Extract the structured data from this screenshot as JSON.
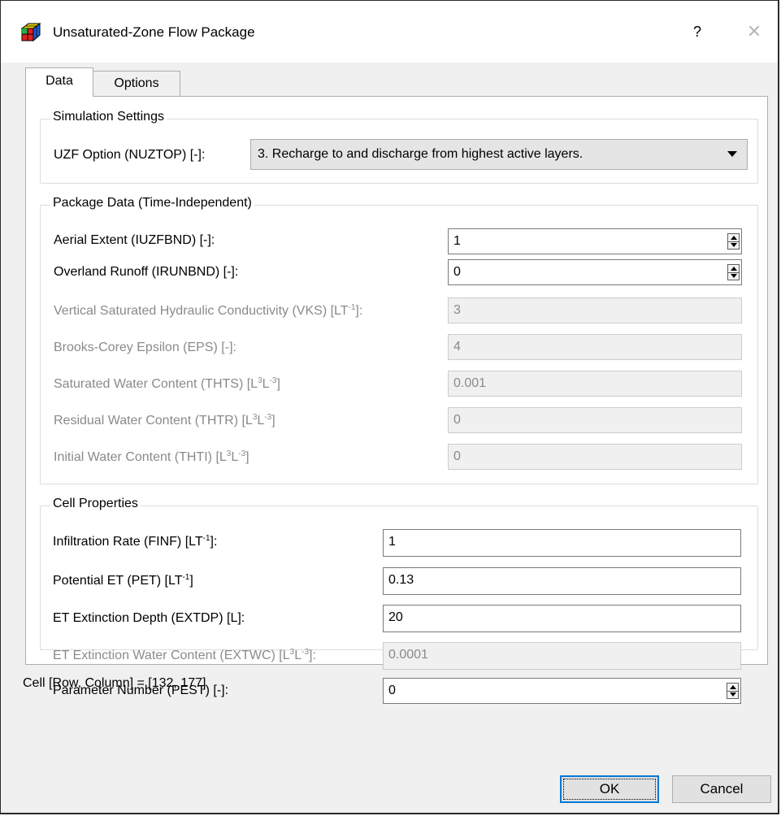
{
  "window": {
    "title": "Unsaturated-Zone Flow Package",
    "help_label": "?",
    "close_label": "✕"
  },
  "tabs": [
    {
      "label": "Data",
      "selected": true
    },
    {
      "label": "Options",
      "selected": false
    }
  ],
  "simulation_settings": {
    "title": "Simulation Settings",
    "uzf_option_label": "UZF Option (NUZTOP) [-]:",
    "uzf_option_value": "3. Recharge to and discharge from highest active layers."
  },
  "package_data": {
    "title": "Package Data (Time-Independent)",
    "aerial_extent": {
      "label": "Aerial Extent (IUZFBND) [-]:",
      "value": "1"
    },
    "overland_runoff": {
      "label": "Overland Runoff (IRUNBND) [-]:",
      "value": "0"
    },
    "vks": {
      "label_pre": "Vertical Saturated Hydraulic Conductivity (VKS) [LT",
      "label_sup": "-1",
      "label_post": "]:",
      "value": "3"
    },
    "eps": {
      "label": "Brooks-Corey Epsilon (EPS) [-]:",
      "value": "4"
    },
    "thts": {
      "label_pre": "Saturated Water Content (THTS) [L",
      "sup1": "3",
      "label_mid": "L",
      "sup2": "-3",
      "label_post": "]",
      "value": "0.001"
    },
    "thtr": {
      "label_pre": "Residual Water Content (THTR) [L",
      "sup1": "3",
      "label_mid": "L",
      "sup2": "-3",
      "label_post": "]",
      "value": "0"
    },
    "thti": {
      "label_pre": "Initial Water Content (THTI) [L",
      "sup1": "3",
      "label_mid": "L",
      "sup2": "-3",
      "label_post": "]",
      "value": "0"
    }
  },
  "cell_properties": {
    "title": "Cell Properties",
    "finf": {
      "label_pre": "Infiltration Rate (FINF) [LT",
      "label_sup": "-1",
      "label_post": "]:",
      "value": "1"
    },
    "pet": {
      "label_pre": "Potential ET (PET) [LT",
      "label_sup": "-1",
      "label_post": "]",
      "value": "0.13"
    },
    "extdp": {
      "label": "ET Extinction Depth (EXTDP) [L]:",
      "value": "20"
    },
    "extwc": {
      "label_pre": "ET Extinction Water Content (EXTWC) [L",
      "sup1": "3",
      "label_mid": "L",
      "sup2": "-3",
      "label_post": "]:",
      "value": "0.0001"
    },
    "pest": {
      "label": "Parameter Number (PEST) [-]:",
      "value": "0"
    }
  },
  "status": "Cell [Row, Column] = [132, 177]",
  "buttons": {
    "ok": "OK",
    "cancel": "Cancel"
  }
}
